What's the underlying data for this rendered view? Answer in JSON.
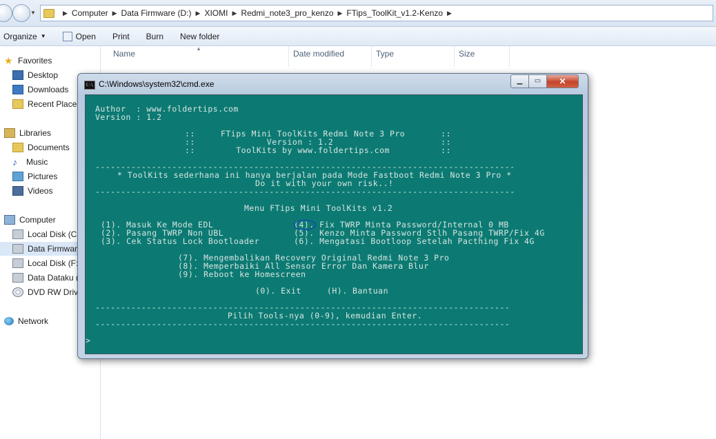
{
  "explorer": {
    "breadcrumb": [
      "Computer",
      "Data Firmware (D:)",
      "XIOMI",
      "Redmi_note3_pro_kenzo",
      "FTips_ToolKit_v1.2-Kenzo"
    ],
    "toolbar": {
      "organize": "Organize",
      "open": "Open",
      "print": "Print",
      "burn": "Burn",
      "new_folder": "New folder"
    },
    "columns": {
      "name": "Name",
      "date_modified": "Date modified",
      "type": "Type",
      "size": "Size"
    },
    "nav": {
      "favorites": "Favorites",
      "desktop": "Desktop",
      "downloads": "Downloads",
      "recent_places": "Recent Places",
      "libraries": "Libraries",
      "documents": "Documents",
      "music": "Music",
      "pictures": "Pictures",
      "videos": "Videos",
      "computer": "Computer",
      "local_c": "Local Disk (C:)",
      "data_firmware": "Data Firmware",
      "local_f": "Local Disk (F:)",
      "data_dataku": "Data Dataku (",
      "dvd": "DVD RW Drive",
      "network": "Network"
    }
  },
  "cmd": {
    "title": "C:\\Windows\\system32\\cmd.exe",
    "lines": {
      "author": "Author  : www.foldertips.com",
      "version": "Version : 1.2",
      "banner1": "::     FTips Mini ToolKits Redmi Note 3 Pro       ::",
      "banner2": "::              Version : 1.2                     ::",
      "banner3": "::        ToolKits by www.foldertips.com          ::",
      "dash1": "----------------------------------------------------------------------------------",
      "note1": "* ToolKits sederhana ini hanya berjalan pada Mode Fastboot Redmi Note 3 Pro *",
      "note2": "Do it with your own risk..!",
      "dash2": "----------------------------------------------------------------------------------",
      "menu_title": "Menu FTips Mini ToolKits v1.2",
      "opt1": "(1). Masuk Ke Mode EDL",
      "opt2": "(2). Pasang TWRP Non UBL",
      "opt3": "(3). Cek Status Lock Bootloader",
      "opt4": "(4). Fix TWRP Minta Password/Internal 0 MB",
      "opt5": "(5). Kenzo Minta Password Stlh Pasang TWRP/Fix 4G",
      "opt6": "(6). Mengatasi Bootloop Setelah Pacthing Fix 4G",
      "opt7": "(7). Mengembalikan Recovery Original Redmi Note 3 Pro",
      "opt8": "(8). Memperbaiki All Sensor Error Dan Kamera Blur",
      "opt9": "(9). Reboot ke Homescreen",
      "exit_help": "(0). Exit     (H). Bantuan",
      "dash3": "---------------------------------------------------------------------------------",
      "prompt_text": "Pilih Tools-nya (0-9), kemudian Enter.",
      "dash4": "---------------------------------------------------------------------------------",
      "cursor": ">"
    }
  }
}
